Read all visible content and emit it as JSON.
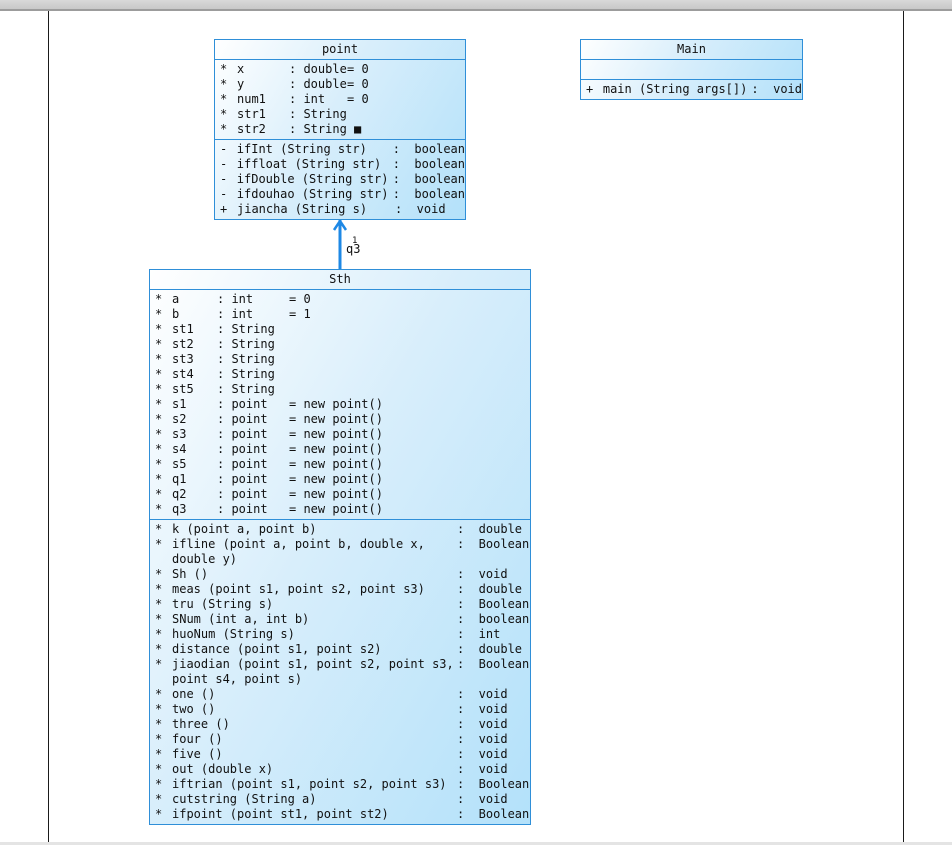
{
  "classes": {
    "point": {
      "name": "point",
      "attributes": [
        {
          "vis": "*",
          "name": "x",
          "type": "double",
          "value": "= 0"
        },
        {
          "vis": "*",
          "name": "y",
          "type": "double",
          "value": "= 0"
        },
        {
          "vis": "*",
          "name": "num1",
          "type": "int",
          "value": "= 0"
        },
        {
          "vis": "*",
          "name": "str1",
          "type": "String",
          "value": ""
        },
        {
          "vis": "*",
          "name": "str2",
          "type": "String ■",
          "value": ""
        }
      ],
      "methods": [
        {
          "vis": "-",
          "sig": "ifInt (String str)",
          "ret": "boolean"
        },
        {
          "vis": "-",
          "sig": "iffloat (String str)",
          "ret": "boolean"
        },
        {
          "vis": "-",
          "sig": "ifDouble (String str)",
          "ret": "boolean"
        },
        {
          "vis": "-",
          "sig": "ifdouhao (String str)",
          "ret": "boolean"
        },
        {
          "vis": "+",
          "sig": "jiancha (String s)",
          "ret": "void"
        }
      ]
    },
    "main": {
      "name": "Main",
      "attributes": [],
      "methods": [
        {
          "vis": "+",
          "sig": "main (String args[])",
          "ret": "void"
        }
      ]
    },
    "sth": {
      "name": "Sth",
      "attributes": [
        {
          "vis": "*",
          "name": "a",
          "type": "int",
          "value": "= 0"
        },
        {
          "vis": "*",
          "name": "b",
          "type": "int",
          "value": "= 1"
        },
        {
          "vis": "*",
          "name": "st1",
          "type": "String",
          "value": ""
        },
        {
          "vis": "*",
          "name": "st2",
          "type": "String",
          "value": ""
        },
        {
          "vis": "*",
          "name": "st3",
          "type": "String",
          "value": ""
        },
        {
          "vis": "*",
          "name": "st4",
          "type": "String",
          "value": ""
        },
        {
          "vis": "*",
          "name": "st5",
          "type": "String",
          "value": ""
        },
        {
          "vis": "*",
          "name": "s1",
          "type": "point",
          "value": "= new point()"
        },
        {
          "vis": "*",
          "name": "s2",
          "type": "point",
          "value": "= new point()"
        },
        {
          "vis": "*",
          "name": "s3",
          "type": "point",
          "value": "= new point()"
        },
        {
          "vis": "*",
          "name": "s4",
          "type": "point",
          "value": "= new point()"
        },
        {
          "vis": "*",
          "name": "s5",
          "type": "point",
          "value": "= new point()"
        },
        {
          "vis": "*",
          "name": "q1",
          "type": "point",
          "value": "= new point()"
        },
        {
          "vis": "*",
          "name": "q2",
          "type": "point",
          "value": "= new point()"
        },
        {
          "vis": "*",
          "name": "q3",
          "type": "point",
          "value": "= new point()"
        }
      ],
      "methods": [
        {
          "vis": "*",
          "sig": "k (point a, point b)",
          "ret": "double"
        },
        {
          "vis": "*",
          "sig": "ifline (point a, point b, double x, double y)",
          "ret": "Boolean"
        },
        {
          "vis": "*",
          "sig": "Sh ()",
          "ret": "void"
        },
        {
          "vis": "*",
          "sig": "meas (point s1, point s2, point s3)",
          "ret": "double"
        },
        {
          "vis": "*",
          "sig": "tru (String s)",
          "ret": "Boolean"
        },
        {
          "vis": "*",
          "sig": "SNum (int a, int b)",
          "ret": "boolean"
        },
        {
          "vis": "*",
          "sig": "huoNum (String s)",
          "ret": "int"
        },
        {
          "vis": "*",
          "sig": "distance (point s1, point s2)",
          "ret": "double"
        },
        {
          "vis": "*",
          "sig": "jiaodian (point s1, point s2, point s3, point s4, point s)",
          "ret": "Boolean"
        },
        {
          "vis": "*",
          "sig": "one ()",
          "ret": "void"
        },
        {
          "vis": "*",
          "sig": "two ()",
          "ret": "void"
        },
        {
          "vis": "*",
          "sig": "three ()",
          "ret": "void"
        },
        {
          "vis": "*",
          "sig": "four ()",
          "ret": "void"
        },
        {
          "vis": "*",
          "sig": "five ()",
          "ret": "void"
        },
        {
          "vis": "*",
          "sig": "out (double x)",
          "ret": "void"
        },
        {
          "vis": "*",
          "sig": "iftrian (point s1, point s2, point s3)",
          "ret": "Boolean"
        },
        {
          "vis": "*",
          "sig": "cutstring (String a)",
          "ret": "void"
        },
        {
          "vis": "*",
          "sig": "ifpoint (point st1, point st2)",
          "ret": "Boolean"
        }
      ]
    }
  },
  "association": {
    "label": "q3",
    "multiplicity": "1",
    "color": "#1e88e5"
  },
  "colors": {
    "class_border": "#2f8fd8",
    "class_fill": "#b3e1fa",
    "arrow": "#1e88e5"
  }
}
